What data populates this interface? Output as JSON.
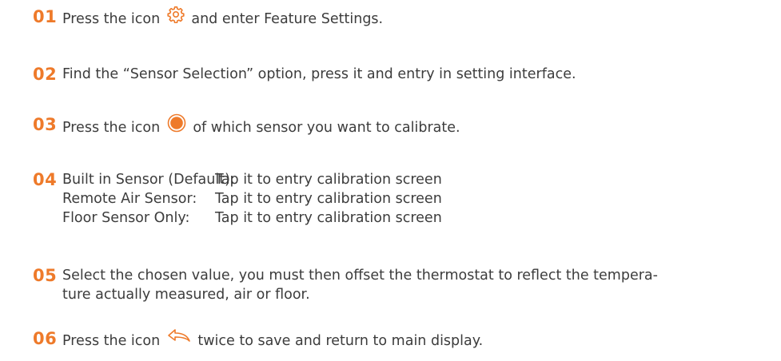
{
  "steps": [
    {
      "num": "01",
      "before": "Press the icon",
      "icon": "gear-icon",
      "after": "and enter Feature Settings."
    },
    {
      "num": "02",
      "text": "Find the “Sensor Selection” option, press it and entry in setting interface."
    },
    {
      "num": "03",
      "before": "Press the icon",
      "icon": "radio-selected-icon",
      "after": "of which sensor you want to calibrate."
    },
    {
      "num": "04",
      "rows": [
        {
          "label": "Built in Sensor (Default):",
          "action": "Tap it to entry calibration screen"
        },
        {
          "label": "Remote Air Sensor:",
          "action": "Tap it to entry calibration screen"
        },
        {
          "label": "Floor Sensor Only:",
          "action": "Tap it to entry calibration screen"
        }
      ]
    },
    {
      "num": "05",
      "text": "Select the chosen value, you must then offset the thermostat to reflect the tempera-",
      "text2": "ture actually measured, air or floor."
    },
    {
      "num": "06",
      "before": "Press the icon",
      "icon": "back-arrow-icon",
      "after": "twice to save and return to main display."
    }
  ],
  "colors": {
    "accent": "#ee7a2a",
    "text": "#3c3c3c"
  }
}
